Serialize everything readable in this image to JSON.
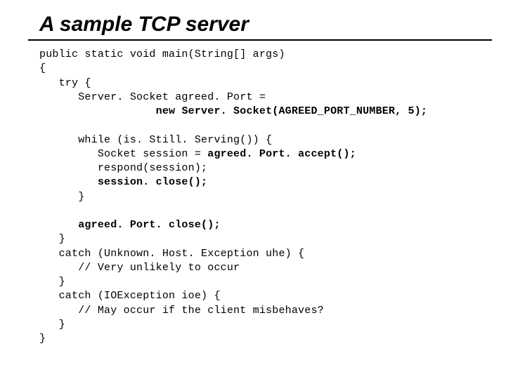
{
  "title": "A sample TCP server",
  "code": {
    "l1": "public static void main(String[] args)",
    "l2": "{",
    "l3": "   try {",
    "l4": "      Server. Socket agreed. Port =",
    "l5a": "                  ",
    "l5b": "new Server. Socket(AGREED_PORT_NUMBER, 5);",
    "l6": "",
    "l7": "      while (is. Still. Serving()) {",
    "l8a": "         Socket session = ",
    "l8b": "agreed. Port. accept();",
    "l9": "         respond(session);",
    "l10": "         session. close();",
    "l11": "      }",
    "l12": "",
    "l13": "      agreed. Port. close();",
    "l14": "   }",
    "l15": "   catch (Unknown. Host. Exception uhe) {",
    "l16": "      // Very unlikely to occur",
    "l17": "   }",
    "l18": "   catch (IOException ioe) {",
    "l19": "      // May occur if the client misbehaves?",
    "l20": "   }",
    "l21": "}"
  }
}
